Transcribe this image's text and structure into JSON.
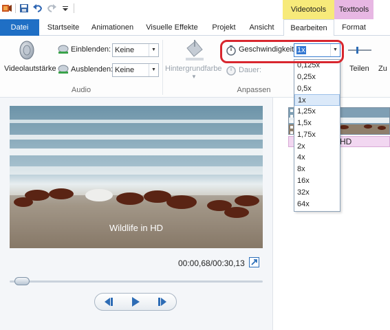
{
  "context_tabs": {
    "videotools": "Videotools",
    "texttools": "Texttools"
  },
  "tabs": [
    {
      "label": "Datei"
    },
    {
      "label": "Startseite"
    },
    {
      "label": "Animationen"
    },
    {
      "label": "Visuelle Effekte"
    },
    {
      "label": "Projekt"
    },
    {
      "label": "Ansicht"
    },
    {
      "label": "Bearbeiten"
    },
    {
      "label": "Format"
    }
  ],
  "ribbon": {
    "audio": {
      "video_volume_label": "Videolautstärke",
      "fade_in_label": "Einblenden:",
      "fade_in_value": "Keine",
      "fade_out_label": "Ausblenden:",
      "fade_out_value": "Keine",
      "group_label": "Audio"
    },
    "adjust": {
      "background_color_label": "Hintergrundfarbe",
      "speed_label": "Geschwindigkeit:",
      "speed_value": "1x",
      "duration_label": "Dauer:",
      "split_label": "Teilen",
      "more_label": "Zu",
      "group_label": "Anpassen"
    }
  },
  "speed_options": [
    "0,125x",
    "0,25x",
    "0,5x",
    "1x",
    "1,25x",
    "1,5x",
    "1,75x",
    "2x",
    "4x",
    "8x",
    "16x",
    "32x",
    "64x"
  ],
  "speed_selected": "1x",
  "preview": {
    "video_caption": "Wildlife in HD",
    "timecode": "00:00,68/00:30,13",
    "seek_progress": 0.02
  },
  "storyboard": {
    "clip_caption": "HD"
  },
  "colors": {
    "file_tab": "#1f6fc5",
    "videotools": "#f7ea7a",
    "texttools": "#e7b7e3",
    "highlight": "#d8262e"
  }
}
